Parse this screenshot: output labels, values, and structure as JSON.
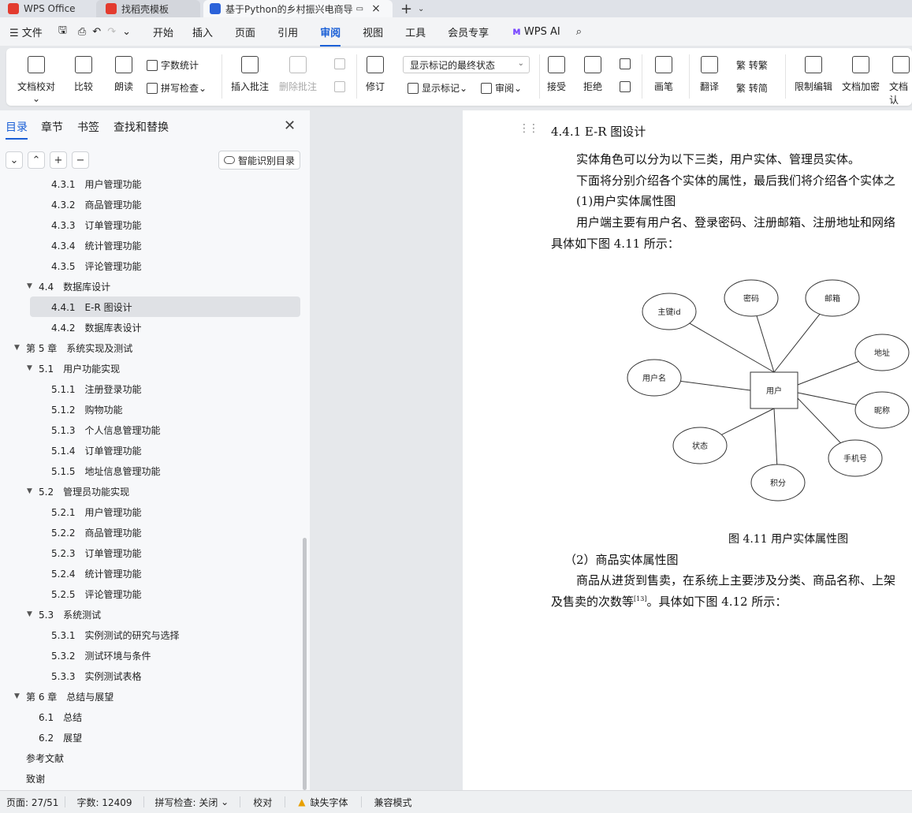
{
  "tabs": [
    {
      "label": "WPS Office",
      "color": "#e33b2e"
    },
    {
      "label": "找稻壳模板",
      "color": "#e33b2e"
    },
    {
      "label": "基于Python的乡村振兴电商导",
      "color": "#2b62d9"
    }
  ],
  "menu": {
    "file": "文件",
    "items": [
      "开始",
      "插入",
      "页面",
      "引用",
      "审阅",
      "视图",
      "工具",
      "会员专享"
    ],
    "active": "审阅",
    "ai": "WPS AI"
  },
  "ribbon": {
    "doc_check": "文档校对",
    "compare": "比较",
    "read_aloud": "朗读",
    "word_count": "字数统计",
    "spell_check": "拼写检查",
    "insert_comment": "插入批注",
    "delete_comment": "删除批注",
    "revise": "修订",
    "markup_state": "显示标记的最终状态",
    "show_markup": "显示标记",
    "review": "审阅",
    "accept": "接受",
    "reject": "拒绝",
    "pen": "画笔",
    "translate": "翻译",
    "trad": "繁 转繁",
    "simp": "繁 转简",
    "restrict_edit": "限制编辑",
    "encrypt": "文档加密",
    "doc_more": "文档认"
  },
  "nav": {
    "tabs": [
      "目录",
      "章节",
      "书签",
      "查找和替换"
    ],
    "smart_btn": "智能识别目录",
    "items": [
      {
        "num": "4.3.1",
        "label": "用户管理功能",
        "level": 3
      },
      {
        "num": "4.3.2",
        "label": "商品管理功能",
        "level": 3
      },
      {
        "num": "4.3.3",
        "label": "订单管理功能",
        "level": 3
      },
      {
        "num": "4.3.4",
        "label": "统计管理功能",
        "level": 3
      },
      {
        "num": "4.3.5",
        "label": "评论管理功能",
        "level": 3
      },
      {
        "num": "4.4",
        "label": "数据库设计",
        "level": 2
      },
      {
        "num": "4.4.1",
        "label": "E-R 图设计",
        "level": 3
      },
      {
        "num": "4.4.2",
        "label": "数据库表设计",
        "level": 3
      },
      {
        "num": "第 5 章",
        "label": "系统实现及测试",
        "level": 1
      },
      {
        "num": "5.1",
        "label": "用户功能实现",
        "level": 2
      },
      {
        "num": "5.1.1",
        "label": "注册登录功能",
        "level": 3
      },
      {
        "num": "5.1.2",
        "label": "购物功能",
        "level": 3
      },
      {
        "num": "5.1.3",
        "label": "个人信息管理功能",
        "level": 3
      },
      {
        "num": "5.1.4",
        "label": "订单管理功能",
        "level": 3
      },
      {
        "num": "5.1.5",
        "label": "地址信息管理功能",
        "level": 3
      },
      {
        "num": "5.2",
        "label": "管理员功能实现",
        "level": 2
      },
      {
        "num": "5.2.1",
        "label": "用户管理功能",
        "level": 3
      },
      {
        "num": "5.2.2",
        "label": "商品管理功能",
        "level": 3
      },
      {
        "num": "5.2.3",
        "label": "订单管理功能",
        "level": 3
      },
      {
        "num": "5.2.4",
        "label": "统计管理功能",
        "level": 3
      },
      {
        "num": "5.2.5",
        "label": "评论管理功能",
        "level": 3
      },
      {
        "num": "5.3",
        "label": "系统测试",
        "level": 2
      },
      {
        "num": "5.3.1",
        "label": "实例测试的研究与选择",
        "level": 3
      },
      {
        "num": "5.3.2",
        "label": "测试环境与条件",
        "level": 3
      },
      {
        "num": "5.3.3",
        "label": "实例测试表格",
        "level": 3
      },
      {
        "num": "第 6 章",
        "label": "总结与展望",
        "level": 1
      },
      {
        "num": "6.1",
        "label": "总结",
        "level": 2
      },
      {
        "num": "6.2",
        "label": "展望",
        "level": 2
      },
      {
        "num": "",
        "label": "参考文献",
        "level": 1
      },
      {
        "num": "",
        "label": "致谢",
        "level": 1
      }
    ]
  },
  "doc": {
    "heading": "4.4.1    E-R 图设计",
    "p1": "实体角色可以分为以下三类，用户实体、管理员实体。",
    "p2": "下面将分别介绍各个实体的属性，最后我们将介绍各个实体之",
    "p3": "(1)用户实体属性图",
    "p4": "用户端主要有用户名、登录密码、注册邮箱、注册地址和网络",
    "p5": "具体如下图 4.11 所示：",
    "er": {
      "center": "用户",
      "attrs": [
        "主键id",
        "密码",
        "邮箱",
        "地址",
        "用户名",
        "昵称",
        "状态",
        "手机号",
        "积分"
      ]
    },
    "caption": "图 4.11  用户实体属性图",
    "p6": "（2）商品实体属性图",
    "p7": "商品从进货到售卖，在系统上主要涉及分类、商品名称、上架",
    "p8a": "及售卖的次数等",
    "p8ref": "[13]",
    "p8b": "。具体如下图 4.12 所示："
  },
  "status": {
    "page": "页面: 27/51",
    "words": "字数: 12409",
    "spell": "拼写检查: 关闭",
    "proof": "校对",
    "missing_font": "缺失字体",
    "compat": "兼容模式"
  }
}
